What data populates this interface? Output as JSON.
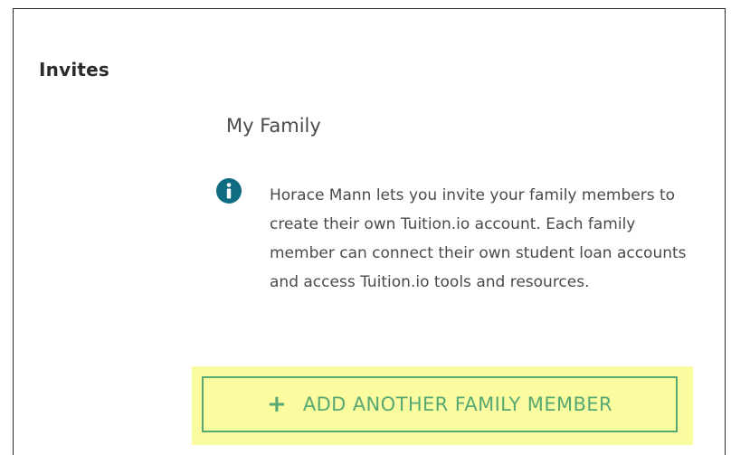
{
  "invites": {
    "section_title": "Invites",
    "family": {
      "title": "My Family",
      "info_icon": "info-circle-icon",
      "info_text": "Horace Mann lets you invite your family members to create their own Tuition.io account. Each family member can connect their own student loan accounts and access Tuition.io tools and resources.",
      "add_button": {
        "icon": "plus-icon",
        "label": "ADD ANOTHER FAMILY MEMBER"
      }
    }
  },
  "colors": {
    "accent_green": "#58a873",
    "info_icon": "#0f6c82",
    "highlight": "#fbfba0",
    "text_dark": "#2b2b2b",
    "text_body": "#4a4a4a"
  }
}
